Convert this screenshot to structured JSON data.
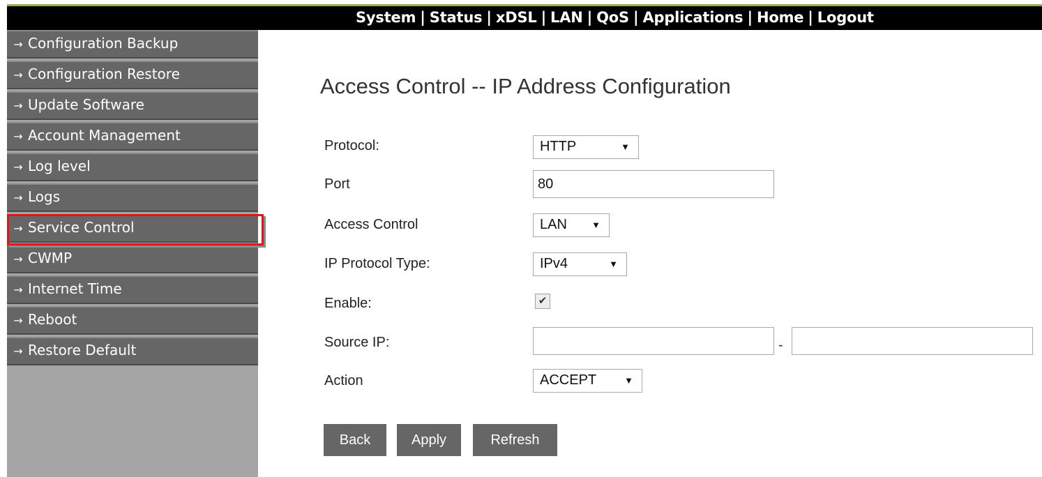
{
  "nav": {
    "items": [
      "System",
      "Status",
      "xDSL",
      "LAN",
      "QoS",
      "Applications",
      "Home",
      "Logout"
    ],
    "separator": "|"
  },
  "sidebar": {
    "items": [
      {
        "label": "Configuration Backup"
      },
      {
        "label": "Configuration Restore"
      },
      {
        "label": "Update Software"
      },
      {
        "label": "Account Management"
      },
      {
        "label": "Log level"
      },
      {
        "label": "Logs"
      },
      {
        "label": "Service Control",
        "highlighted": true
      },
      {
        "label": "CWMP"
      },
      {
        "label": "Internet Time"
      },
      {
        "label": "Reboot"
      },
      {
        "label": "Restore Default"
      }
    ],
    "arrow_glyph": "→",
    "highlight_color": "#e3141c"
  },
  "page": {
    "title": "Access Control -- IP Address Configuration"
  },
  "form": {
    "protocol": {
      "label": "Protocol:",
      "value": "HTTP"
    },
    "port": {
      "label": "Port",
      "value": "80"
    },
    "access_control": {
      "label": "Access Control",
      "value": "LAN"
    },
    "ip_protocol_type": {
      "label": "IP Protocol Type:",
      "value": "IPv4"
    },
    "enable": {
      "label": "Enable:",
      "checked": true,
      "mark": "✔"
    },
    "source_ip": {
      "label": "Source IP:",
      "start": "",
      "end": "",
      "dash": "-"
    },
    "action": {
      "label": "Action",
      "value": "ACCEPT"
    },
    "caret": "▼"
  },
  "buttons": {
    "back": "Back",
    "apply": "Apply",
    "refresh": "Refresh"
  },
  "colors": {
    "topbar": "#000000",
    "sidebar_item": "#666666",
    "sidebar_bg": "#a5a5a5",
    "button": "#666666"
  }
}
